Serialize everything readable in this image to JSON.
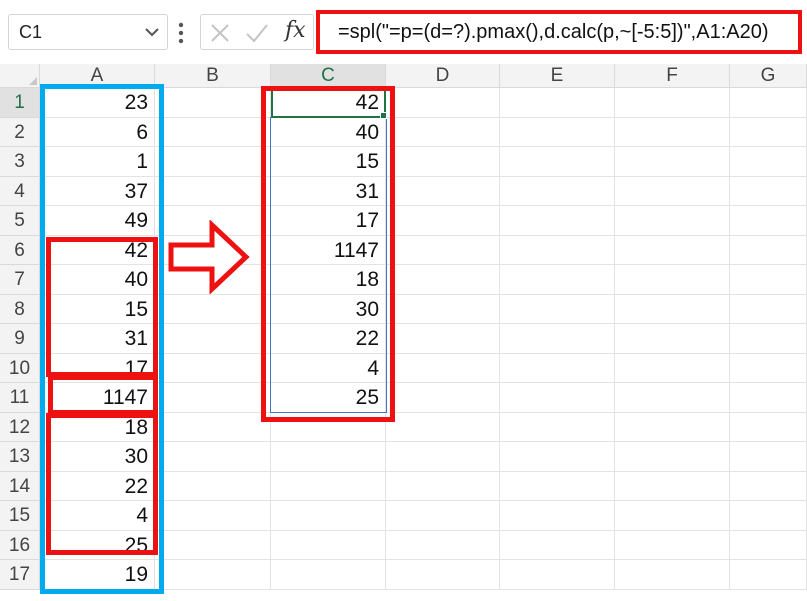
{
  "formula_bar": {
    "name_box": "C1",
    "fx_label": "fx",
    "formula": "=spl(\"=p=(d=?).pmax(),d.calc(p,~[-5:5])\",A1:A20)"
  },
  "columns": [
    "A",
    "B",
    "C",
    "D",
    "E",
    "F",
    "G"
  ],
  "rows": [
    "1",
    "2",
    "3",
    "4",
    "5",
    "6",
    "7",
    "8",
    "9",
    "10",
    "11",
    "12",
    "13",
    "14",
    "15",
    "16",
    "17"
  ],
  "column_a": [
    "23",
    "6",
    "1",
    "37",
    "49",
    "42",
    "40",
    "15",
    "31",
    "17",
    "1147",
    "18",
    "30",
    "22",
    "4",
    "25",
    "19"
  ],
  "column_c": [
    "42",
    "40",
    "15",
    "31",
    "17",
    "1147",
    "18",
    "30",
    "22",
    "4",
    "25"
  ],
  "active_cell": "C1",
  "colors": {
    "highlight_red": "#ee1111",
    "highlight_blue": "#00aaee",
    "selection_green": "#217346"
  }
}
